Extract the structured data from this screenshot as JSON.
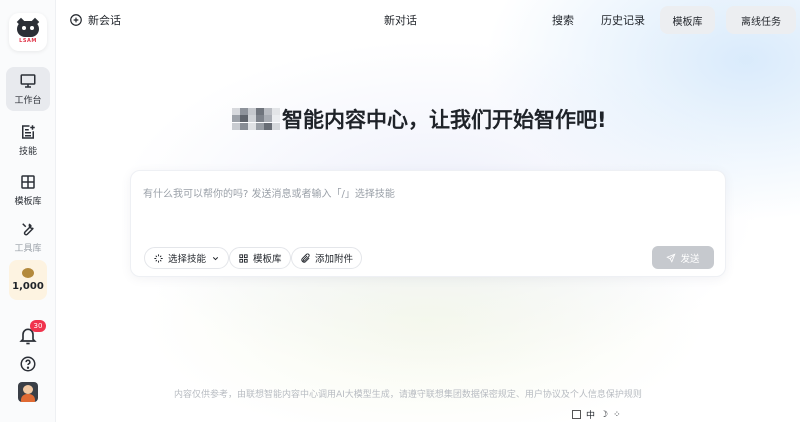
{
  "sidebar": {
    "logo_text": "LSAM",
    "items": [
      {
        "label": "工作台",
        "icon": "monitor-icon",
        "active": true
      },
      {
        "label": "技能",
        "icon": "skills-icon",
        "active": false
      },
      {
        "label": "模板库",
        "icon": "template-icon",
        "active": false
      },
      {
        "label": "工具库",
        "icon": "tools-icon",
        "active": false
      }
    ],
    "points": "1,000",
    "notification_count": "30"
  },
  "topbar": {
    "new_chat": "新会话",
    "title": "新对话",
    "search": "搜索",
    "history": "历史记录",
    "template_btn": "模板库",
    "offline_btn": "离线任务"
  },
  "hero": {
    "title": "智能内容中心，让我们开始智作吧!"
  },
  "composer": {
    "placeholder": "有什么我可以帮你的吗? 发送消息或者输入「/」选择技能",
    "skill_chip": "选择技能",
    "template_chip": "模板库",
    "attach_chip": "添加附件",
    "send": "发送"
  },
  "footer": {
    "disclaimer": "内容仅供参考，由联想智能内容中心调用AI大模型生成，请遵守联想集团数据保密规定、用户协议及个人信息保护规则",
    "ime_label": "中"
  },
  "colors": {
    "badge": "#f0334d",
    "active_nav_bg": "#e8eaee",
    "send_disabled": "#c6c9ce"
  }
}
